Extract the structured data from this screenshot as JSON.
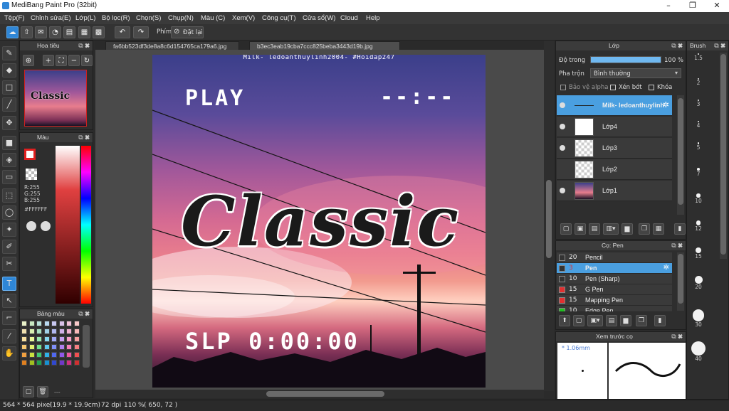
{
  "window": {
    "title": "MediBang Paint Pro (32bit)",
    "minimize": "–",
    "maximize": "❐",
    "close": "✕"
  },
  "menu": [
    "Tệp(F)",
    "Chỉnh sửa(E)",
    "Lớp(L)",
    "Bộ lọc(R)",
    "Chọn(S)",
    "Chụp(N)",
    "Màu (C)",
    "Xem(V)",
    "Công cụ(T)",
    "Cửa sổ(W)",
    "Cloud",
    "Help"
  ],
  "toolbar": {
    "shortcut_label": "Phím",
    "reset_label": "Đặt lại"
  },
  "tabs": [
    {
      "label": "fa6bb523df3de8a8c6d154765ca179a6.jpg",
      "active": false
    },
    {
      "label": "b3ec3eab19cba7ccc825beba3443d19b.jpg",
      "active": true
    }
  ],
  "navigator": {
    "title": "Hoa tiêu"
  },
  "color_panel": {
    "title": "Màu",
    "r": "R:255",
    "g": "G:255",
    "b": "B:255",
    "hex": "#FFFFFF",
    "fg_color": "#e02020",
    "bg_color": "#ffffff"
  },
  "palette_panel": {
    "title": "Bảng màu",
    "footer": "---",
    "colors": [
      "#e8f0c8",
      "#c8e8c0",
      "#b8e0d8",
      "#b8d8f0",
      "#c8c8f0",
      "#d8c0e8",
      "#f0c0d8",
      "#f8c8c8",
      "#f0e0b0",
      "#d8f0b0",
      "#a8e0c0",
      "#a0d0e8",
      "#b0b8f0",
      "#d0b0e8",
      "#f0b0d0",
      "#f8b8b8",
      "#f8e0a0",
      "#e8f898",
      "#98e8b0",
      "#88d8f0",
      "#a0a8f8",
      "#c8a0f0",
      "#f8a0c8",
      "#f8a0a0",
      "#f8c870",
      "#e0f070",
      "#70e090",
      "#60c8f0",
      "#8090f8",
      "#b080f0",
      "#f880b8",
      "#f88080",
      "#f0a040",
      "#c8e040",
      "#40c870",
      "#30b0e8",
      "#5068f0",
      "#9058e8",
      "#f058a0",
      "#f05050",
      "#e08020",
      "#a0c020",
      "#20a050",
      "#1890d0",
      "#3048d0",
      "#7038c8",
      "#d03080",
      "#d03030"
    ]
  },
  "canvas": {
    "watermark": "Milk- ledoanthuylinh2004- #Hoidap247",
    "play_text": "PLAY",
    "time_text": "--:--",
    "title_text": "Classic",
    "slp_text": "SLP 0:00:00"
  },
  "layers_panel": {
    "title": "Lớp",
    "opacity_label": "Độ trong",
    "opacity_value": "100 %",
    "opacity_fraction": 1.0,
    "blend_label": "Pha trộn",
    "blend_value": "Bình thường",
    "protect_alpha": "Bảo vệ alpha",
    "clipping": "Xén bớt",
    "lock": "Khóa",
    "layers": [
      {
        "name": "Milk- ledoanthuylinh",
        "selected": true,
        "visible": true
      },
      {
        "name": "Lớp4",
        "selected": false,
        "visible": true
      },
      {
        "name": "Lớp3",
        "selected": false,
        "visible": true
      },
      {
        "name": "Lớp2",
        "selected": false,
        "visible": false
      },
      {
        "name": "Lớp1",
        "selected": false,
        "visible": true
      }
    ]
  },
  "brush_panel": {
    "title": "Cọ: Pen",
    "brushes": [
      {
        "size": "20",
        "name": "Pencil",
        "color": "#333333",
        "selected": false
      },
      {
        "size": "3",
        "name": "Pen",
        "color": "#333333",
        "selected": true
      },
      {
        "size": "10",
        "name": "Pen (Sharp)",
        "color": "#333333",
        "selected": false
      },
      {
        "size": "15",
        "name": "G Pen",
        "color": "#e03030",
        "selected": false
      },
      {
        "size": "15",
        "name": "Mapping Pen",
        "color": "#e03030",
        "selected": false
      },
      {
        "size": "10",
        "name": "Edge Pen",
        "color": "#20c020",
        "selected": false
      }
    ]
  },
  "preview_panel": {
    "title": "Xem trước cọ",
    "size_label": "* 1.06mm"
  },
  "brush_size_panel": {
    "title": "Brush",
    "sizes": [
      "1.5",
      "2",
      "3",
      "4",
      "5",
      "7",
      "10",
      "12",
      "15",
      "20",
      "30",
      "40"
    ]
  },
  "status": {
    "size": "564 * 564 pixel",
    "physical": "(19.9 * 19.9cm)",
    "dpi": "72 dpi",
    "zoom": "110 %",
    "coords": "( 650, 72 )"
  }
}
